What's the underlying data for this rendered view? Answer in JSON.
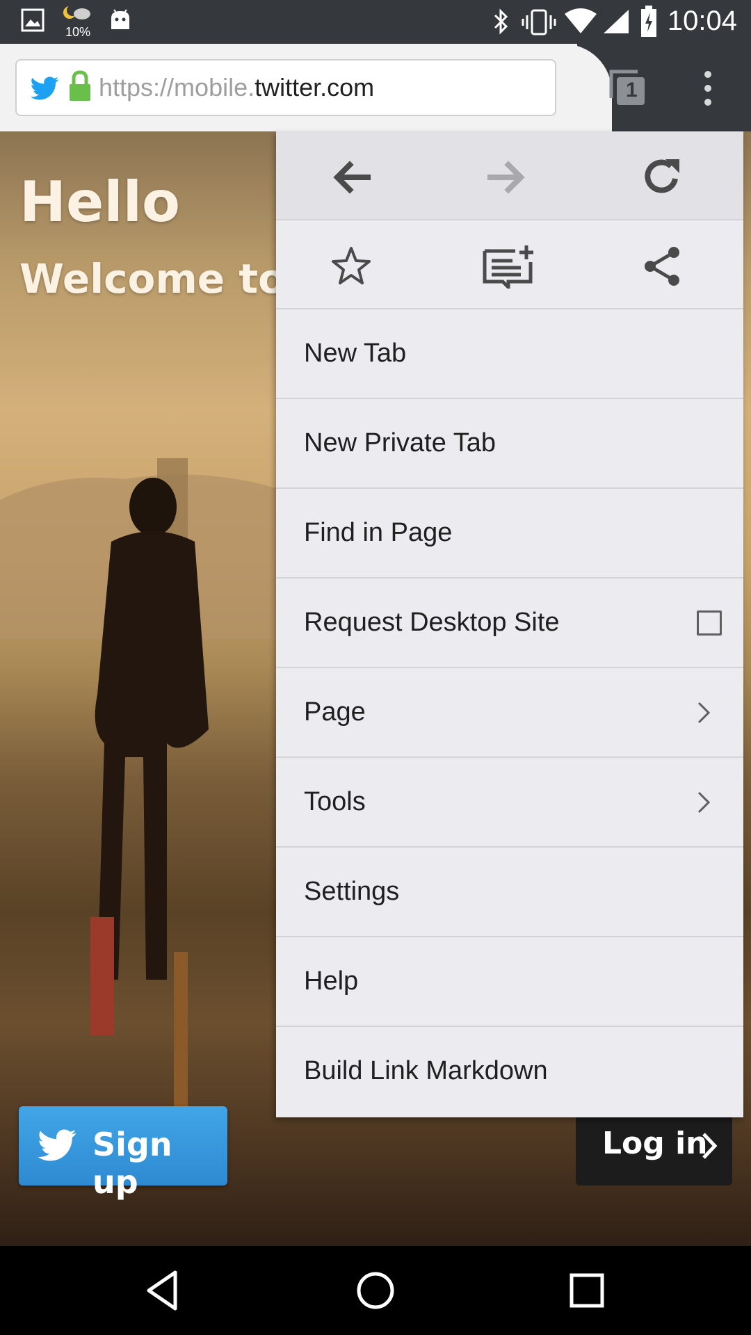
{
  "status_bar": {
    "time": "10:04",
    "weather_percent": "10%",
    "icons": [
      "image-icon",
      "weather-icon",
      "android-icon",
      "bluetooth-icon",
      "vibrate-icon",
      "wifi-icon",
      "signal-icon",
      "battery-icon"
    ]
  },
  "toolbar": {
    "url_prefix": "https://mobile.",
    "url_domain": "twitter.com",
    "tab_count": "1",
    "accent_secure": "#6abf4b",
    "twitter_blue": "#1da1f2"
  },
  "page": {
    "title": "Hello",
    "subtitle": "Welcome to",
    "signup_label": "Sign up",
    "login_label": "Log in"
  },
  "menu": {
    "nav_icons": [
      "back-arrow-icon",
      "forward-arrow-icon",
      "reload-icon"
    ],
    "action_icons": [
      "star-icon",
      "reading-list-add-icon",
      "share-icon"
    ],
    "items": [
      {
        "label": "New Tab"
      },
      {
        "label": "New Private Tab"
      },
      {
        "label": "Find in Page"
      },
      {
        "label": "Request Desktop Site",
        "checkbox": false
      },
      {
        "label": "Page",
        "submenu": true
      },
      {
        "label": "Tools",
        "submenu": true
      },
      {
        "label": "Settings"
      },
      {
        "label": "Help"
      },
      {
        "label": "Build Link Markdown"
      }
    ]
  },
  "nav_bar": {
    "buttons": [
      "back-triangle-icon",
      "home-circle-icon",
      "recents-square-icon"
    ]
  }
}
